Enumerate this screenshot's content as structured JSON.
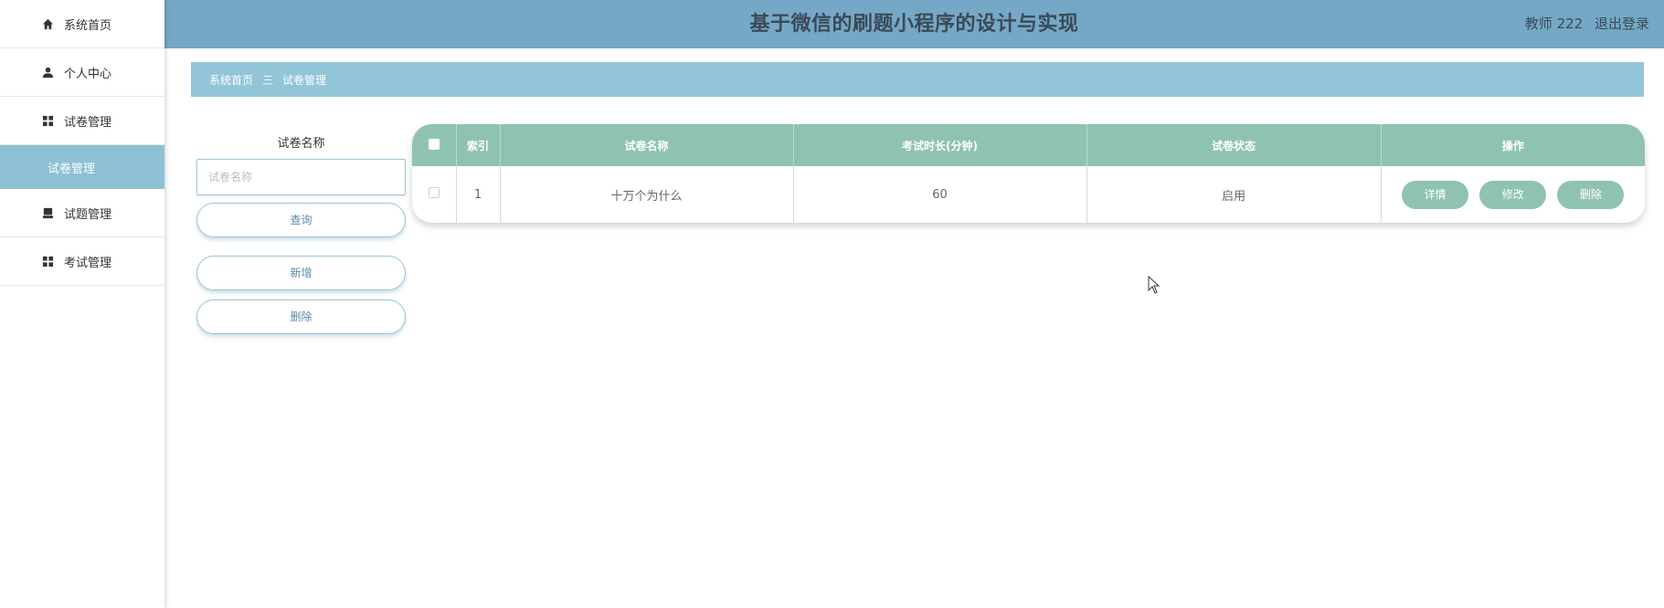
{
  "sidebar": {
    "items": [
      {
        "label": "系统首页",
        "icon": "home-icon"
      },
      {
        "label": "个人中心",
        "icon": "user-icon"
      },
      {
        "label": "试卷管理",
        "icon": "grid-icon"
      },
      {
        "label": "试题管理",
        "icon": "monitor-icon"
      },
      {
        "label": "考试管理",
        "icon": "grid-icon"
      }
    ],
    "sub_item": "试卷管理"
  },
  "header": {
    "title": "基于微信的刷题小程序的设计与实现",
    "user_label": "教师 222",
    "logout": "退出登录"
  },
  "breadcrumb": {
    "home": "系统首页",
    "separator": "三",
    "current": "试卷管理"
  },
  "search": {
    "label": "试卷名称",
    "placeholder": "试卷名称",
    "query_button": "查询",
    "add_button": "新增",
    "delete_button": "删除"
  },
  "table": {
    "columns": [
      "索引",
      "试卷名称",
      "考试时长(分钟)",
      "试卷状态",
      "操作"
    ],
    "rows": [
      {
        "index": "1",
        "name": "十万个为什么",
        "duration": "60",
        "status": "启用"
      }
    ],
    "actions": {
      "detail": "详情",
      "edit": "修改",
      "delete": "删除"
    }
  },
  "colors": {
    "header_bg": "#74a8c6",
    "breadcrumb_bg": "#93c5d8",
    "table_header_bg": "#8fc2b2",
    "active_sub_bg": "#8ec0d4"
  }
}
